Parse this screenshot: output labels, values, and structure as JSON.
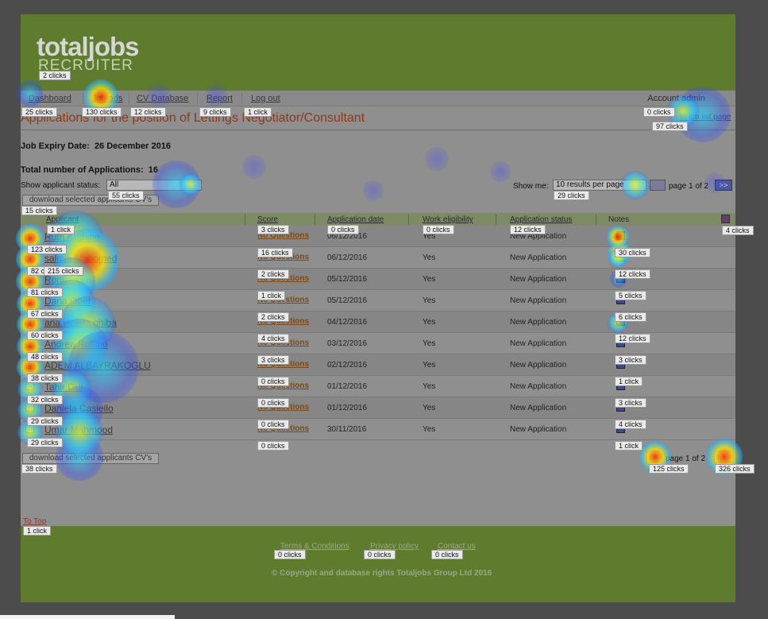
{
  "logo": {
    "main": "totaljobs",
    "sub": "RECRUITER"
  },
  "nav": {
    "items": [
      {
        "label": "Dashboard"
      },
      {
        "label": "Job ads"
      },
      {
        "label": "CV Database"
      },
      {
        "label": "Report"
      },
      {
        "label": "Log out"
      }
    ],
    "account": "Account admin"
  },
  "page": {
    "title": "Applications for the position of Lettings Negotiator/Consultant",
    "back_link": "to job list page",
    "expiry_label": "Job Expiry Date:",
    "expiry_value": "26 December 2016",
    "total_label": "Total number of Applications:",
    "total_value": "16",
    "status_label": "Show applicant status:",
    "status_value": "All",
    "showme_label": "Show me:",
    "per_page_value": "10 results per page",
    "pager_text": "page 1 of 2",
    "next_label": ">>",
    "download_label": "download selected applicants CV's",
    "to_top": "To Top"
  },
  "table": {
    "headers": [
      "Applicant",
      "Score",
      "Application date",
      "Work eligibility",
      "Application status",
      "Notes"
    ],
    "rows": [
      {
        "name": "Ruth Kudahe",
        "score": "No Questions",
        "date": "06/12/2016",
        "eligibility": "Yes",
        "status": "New Application"
      },
      {
        "name": "salmin Mahomed",
        "score": "No Questions",
        "date": "06/12/2016",
        "eligibility": "Yes",
        "status": "New Application"
      },
      {
        "name": "Ronick G",
        "score": "No Questions",
        "date": "05/12/2016",
        "eligibility": "Yes",
        "status": "New Application"
      },
      {
        "name": "Dana Ober",
        "score": "No Questions",
        "date": "05/12/2016",
        "eligibility": "Yes",
        "status": "New Application"
      },
      {
        "name": "ana violeta ghiba",
        "score": "No Questions",
        "date": "04/12/2016",
        "eligibility": "Yes",
        "status": "New Application"
      },
      {
        "name": "Andrea Ruffino",
        "score": "No Questions",
        "date": "03/12/2016",
        "eligibility": "Yes",
        "status": "New Application"
      },
      {
        "name": "ADEM ALBAYRAKOGLU",
        "score": "No Questions",
        "date": "02/12/2016",
        "eligibility": "Yes",
        "status": "New Application"
      },
      {
        "name": "Tahir Gul",
        "score": "No Questions",
        "date": "01/12/2016",
        "eligibility": "Yes",
        "status": "New Application"
      },
      {
        "name": "Daniela Casiello",
        "score": "No Questions",
        "date": "01/12/2016",
        "eligibility": "Yes",
        "status": "New Application"
      },
      {
        "name": "Umar Mahmood",
        "score": "No Questions",
        "date": "30/11/2016",
        "eligibility": "Yes",
        "status": "New Application"
      }
    ]
  },
  "footer": {
    "links": [
      "Terms & Conditions",
      "Privacy policy",
      "Contact us"
    ],
    "copyright": "© Copyright and database rights Totaljobs Group Ltd 2016"
  },
  "clicks": {
    "logo": "2 clicks",
    "dashboard": "25 clicks",
    "job_ads": "130 clicks",
    "cv_database": "12 clicks",
    "report": "9 clicks",
    "logout": "1 click",
    "account": "0 clicks",
    "back_link": "97 clicks",
    "status_select": "55 clicks",
    "per_page": "29 clicks",
    "download_top": "15 clicks",
    "header_applicant": "1 click",
    "header_score": "3 clicks",
    "header_date": "0 clicks",
    "header_eligibility": "0 clicks",
    "header_status": "12 clicks",
    "header_notes_icon": "4 clicks",
    "checkboxes": [
      "123 clicks",
      "82 clicks",
      "81 clicks",
      "67 clicks",
      "60 clicks",
      "48 clicks",
      "38 clicks",
      "32 clicks",
      "29 clicks",
      "29 clicks"
    ],
    "names": [
      "",
      "215 clicks",
      "",
      "",
      "",
      "",
      "",
      "",
      "",
      ""
    ],
    "scores": [
      "16 clicks",
      "2 clicks",
      "1 click",
      "2 clicks",
      "4 clicks",
      "3 clicks",
      "0 clicks",
      "0 clicks",
      "0 clicks",
      "0 clicks"
    ],
    "notes": [
      "30 clicks",
      "12 clicks",
      "5 clicks",
      "6 clicks",
      "12 clicks",
      "3 clicks",
      "1 click",
      "3 clicks",
      "4 clicks",
      "1 click"
    ],
    "download_bottom": "38 clicks",
    "prev_bottom": "125 clicks",
    "next_bottom": "326 clicks",
    "to_top": "1 click",
    "terms": "0 clicks",
    "privacy": "0 clicks",
    "contact": "0 clicks"
  }
}
